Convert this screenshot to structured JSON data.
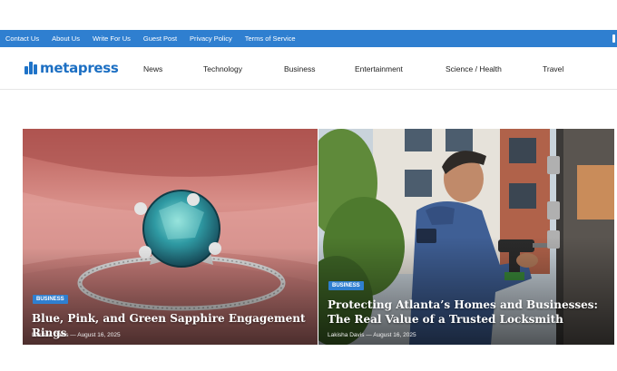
{
  "topbar": {
    "links": [
      "Contact Us",
      "About Us",
      "Write For Us",
      "Guest Post",
      "Privacy Policy",
      "Terms of Service"
    ]
  },
  "logo": {
    "text": "metapress"
  },
  "nav": [
    "News",
    "Technology",
    "Business",
    "Entertainment",
    "Science / Health",
    "Travel"
  ],
  "posts": [
    {
      "category": "BUSINESS",
      "title": "Blue, Pink, and Green Sapphire Engagement Rings",
      "author": "Lakisha Davis",
      "separator": "—",
      "date": "August 16, 2025"
    },
    {
      "category": "BUSINESS",
      "title": "Protecting Atlanta’s Homes and Businesses: The Real Value of a Trusted Locksmith",
      "author": "Lakisha Davis",
      "separator": "—",
      "date": "August 16, 2025"
    }
  ],
  "colors": {
    "accent": "#2f7fd0",
    "logo": "#1c6fc3"
  }
}
